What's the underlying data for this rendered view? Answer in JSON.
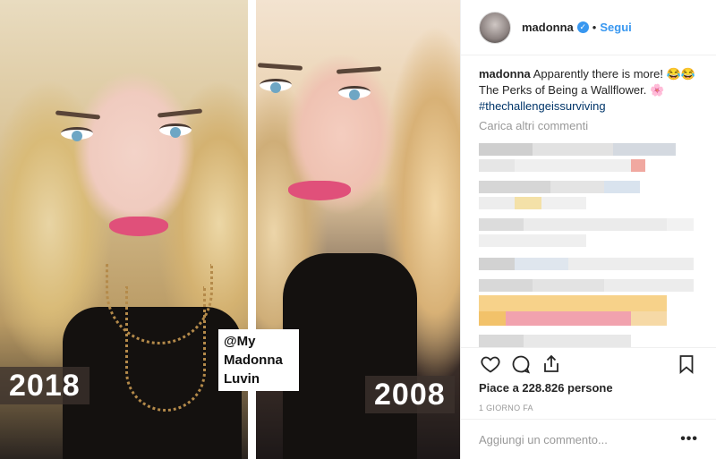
{
  "photo": {
    "left_year": "2018",
    "right_year": "2008",
    "sticker_text": "@My\nMadonna\nLuvin"
  },
  "header": {
    "username": "madonna",
    "verified_icon": "verified-badge-icon",
    "separator": "•",
    "follow_label": "Segui"
  },
  "caption": {
    "username": "madonna",
    "text": "Apparently there is more! 😂😂 The Perks of Being a Wallflower. 🌸",
    "hashtag": "#thechallengeissurviving"
  },
  "comments": {
    "load_more": "Carica altri commenti"
  },
  "actions": {
    "like_icon": "heart-icon",
    "comment_icon": "comment-icon",
    "share_icon": "share-icon",
    "save_icon": "bookmark-icon"
  },
  "likes": "Piace a 228.826 persone",
  "timestamp": "1 GIORNO FA",
  "add_comment": {
    "placeholder": "Aggiungi un commento...",
    "more_icon": "more-options-icon",
    "more_glyph": "•••"
  },
  "colors": {
    "accent": "#3897f0",
    "hashtag": "#003569",
    "muted": "#999999"
  }
}
